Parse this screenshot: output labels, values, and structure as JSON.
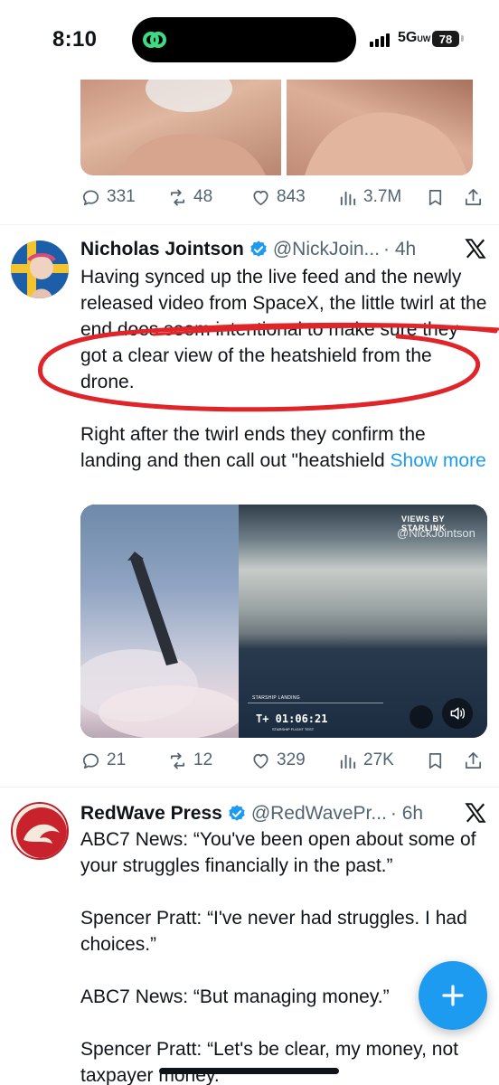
{
  "status_bar": {
    "time": "8:10",
    "network": "5G",
    "network_suffix": "UW",
    "battery": "78"
  },
  "tweet1_actions": {
    "replies": "331",
    "reposts": "48",
    "likes": "843",
    "views": "3.7M"
  },
  "tweet2": {
    "author": "Nicholas Jointson",
    "handle": "@NickJoin...",
    "time": "· 4h",
    "text": "Having synced up the live feed and the newly released video from SpaceX, the little twirl at the end does seem intentional to make sure they got a clear view of the heatshield from the drone.\n\nRight after the twirl ends they confirm the landing and then call out \"heatshield ",
    "show_more": "Show more",
    "video": {
      "credit": "VIEWS BY STARLINK",
      "watermark": "@NickJointson",
      "landing_label": "STARSHIP LANDING",
      "timer": "T+ 01:06:21",
      "flight_label": "STARSHIP FLIGHT TEST"
    },
    "actions": {
      "replies": "21",
      "reposts": "12",
      "likes": "329",
      "views": "27K"
    }
  },
  "tweet3": {
    "author": "RedWave Press",
    "handle": "@RedWavePr...",
    "time": "· 6h",
    "text": "ABC7 News: “You've been open about some of your struggles financially in the past.”\n\nSpencer Pratt: “I've never had struggles. I had choices.”\n\nABC7 News: “But managing money.”\n\nSpencer Pratt: “Let's be clear, my money, not taxpayer money.”"
  },
  "fab": {
    "icon": "plus-icon"
  },
  "colors": {
    "accent": "#1d9bf0",
    "annotation": "#e0252a",
    "verified": "#1d9bf0",
    "muted": "#536471"
  }
}
